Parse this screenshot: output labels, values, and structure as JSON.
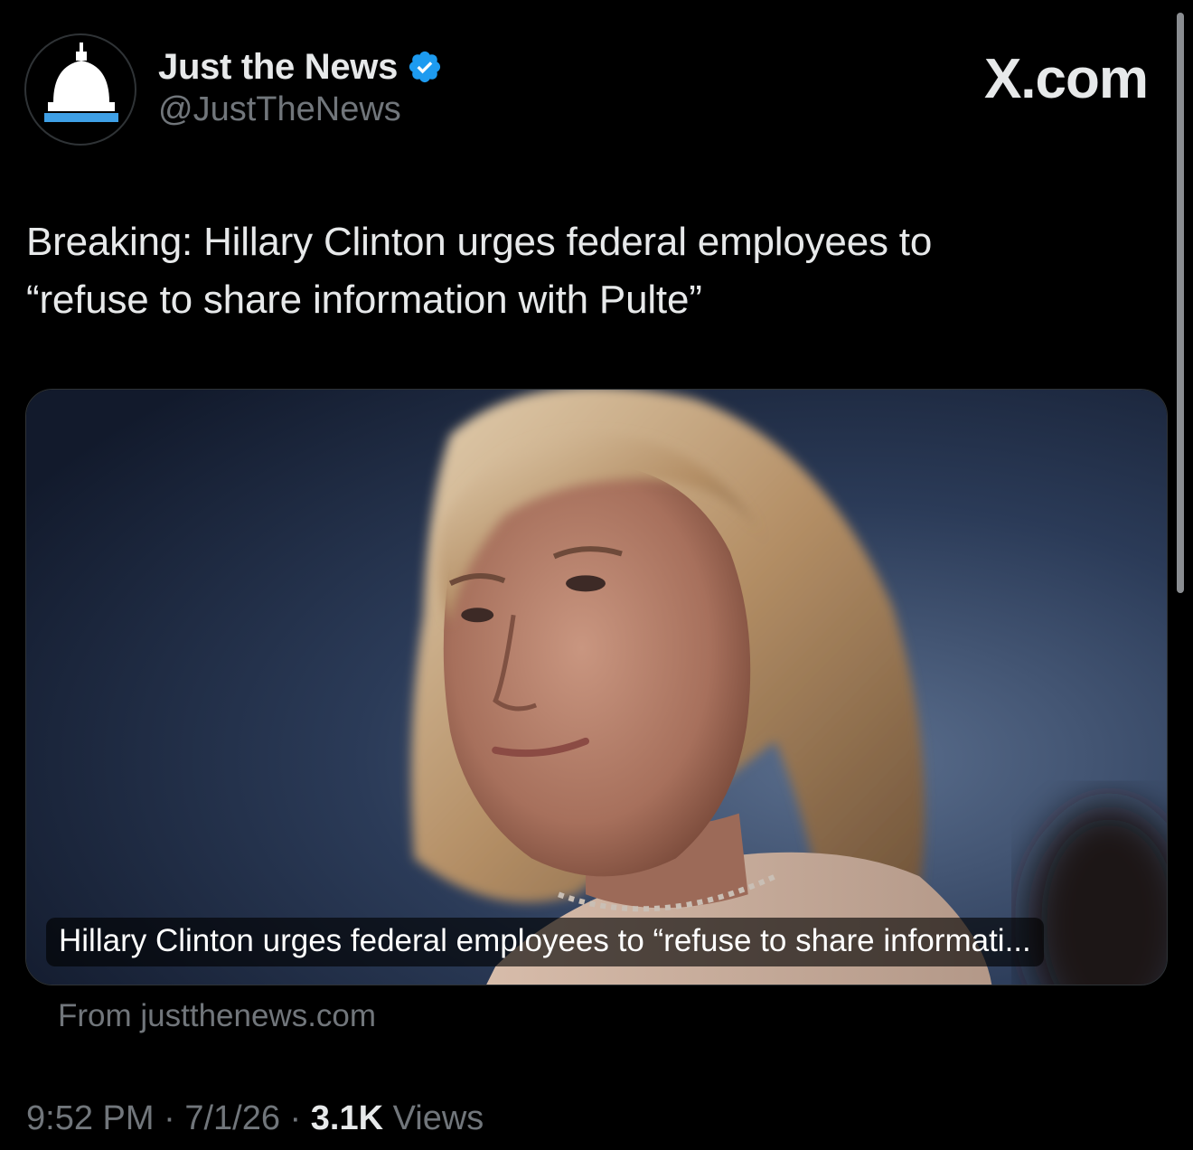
{
  "author": {
    "display_name": "Just the News",
    "handle": "@JustTheNews",
    "verified": true,
    "avatar_icon": "capitol-dome-icon"
  },
  "brand": "X.com",
  "tweet": {
    "text_line1": "Breaking: Hillary Clinton urges federal employees to",
    "text_line2": "“refuse to share information with Pulte”"
  },
  "card": {
    "caption": "Hillary Clinton urges federal employees to “refuse to share informati...",
    "source": "From justthenews.com"
  },
  "meta": {
    "time": "9:52 PM",
    "separator": " · ",
    "date": "7/1/26",
    "views_count": "3.1K",
    "views_label": " Views"
  },
  "colors": {
    "background": "#000000",
    "text": "#e7e9ea",
    "muted": "#71767b",
    "verified_blue": "#1d9bf0",
    "avatar_accent": "#3fa0e6"
  }
}
